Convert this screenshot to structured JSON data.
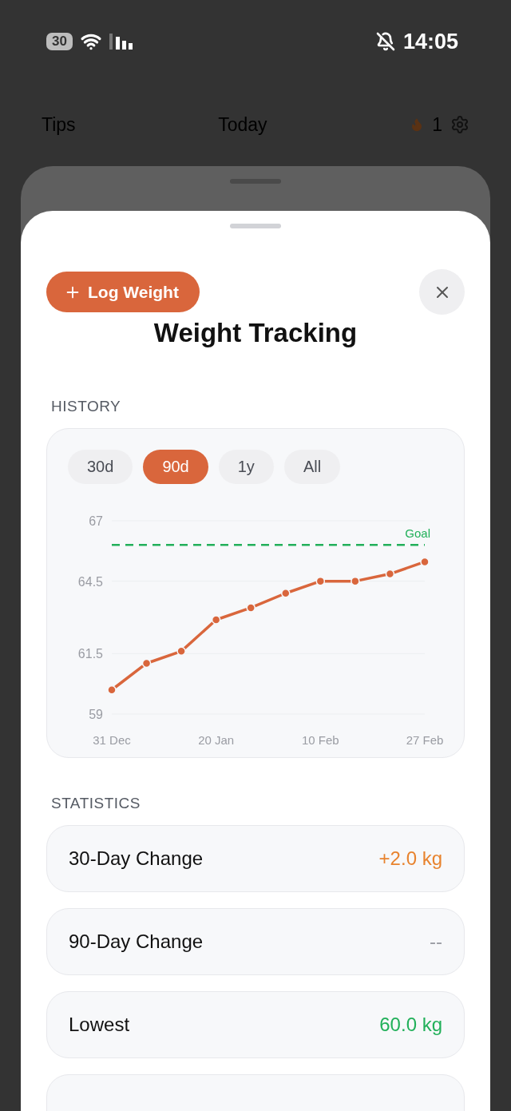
{
  "status_bar": {
    "battery": "30",
    "time": "14:05"
  },
  "nav": {
    "left": "Tips",
    "title": "Today",
    "streak": "1"
  },
  "sheet": {
    "action": "Log Weight",
    "title": "Weight Tracking"
  },
  "history": {
    "heading": "HISTORY",
    "ranges": [
      {
        "label": "30d",
        "selected": false
      },
      {
        "label": "90d",
        "selected": true
      },
      {
        "label": "1y",
        "selected": false
      },
      {
        "label": "All",
        "selected": false
      }
    ],
    "chart_data": {
      "type": "line",
      "categories": [
        "31 Dec",
        null,
        null,
        "20 Jan",
        null,
        null,
        "10 Feb",
        null,
        null,
        "27 Feb"
      ],
      "series": [
        {
          "color": "#d9663c",
          "marker": "circle",
          "values": [
            60.0,
            61.1,
            61.6,
            62.9,
            63.4,
            64.0,
            64.5,
            64.5,
            64.8,
            65.3
          ]
        }
      ],
      "ylim": [
        59,
        67
      ],
      "yticks": [
        59,
        61.5,
        64.5,
        67
      ],
      "ref_lines": [
        {
          "axis": "y",
          "value": 66,
          "label": "Goal",
          "color": "#22b05a"
        }
      ]
    }
  },
  "statistics": {
    "heading": "STATISTICS",
    "items": [
      {
        "label": "30-Day Change",
        "value": "+2.0 kg",
        "color": "#e8832e"
      },
      {
        "label": "90-Day Change",
        "value": "--",
        "color": "#9a9ca3"
      },
      {
        "label": "Lowest",
        "value": "60.0 kg",
        "color": "#22b05a"
      }
    ]
  }
}
